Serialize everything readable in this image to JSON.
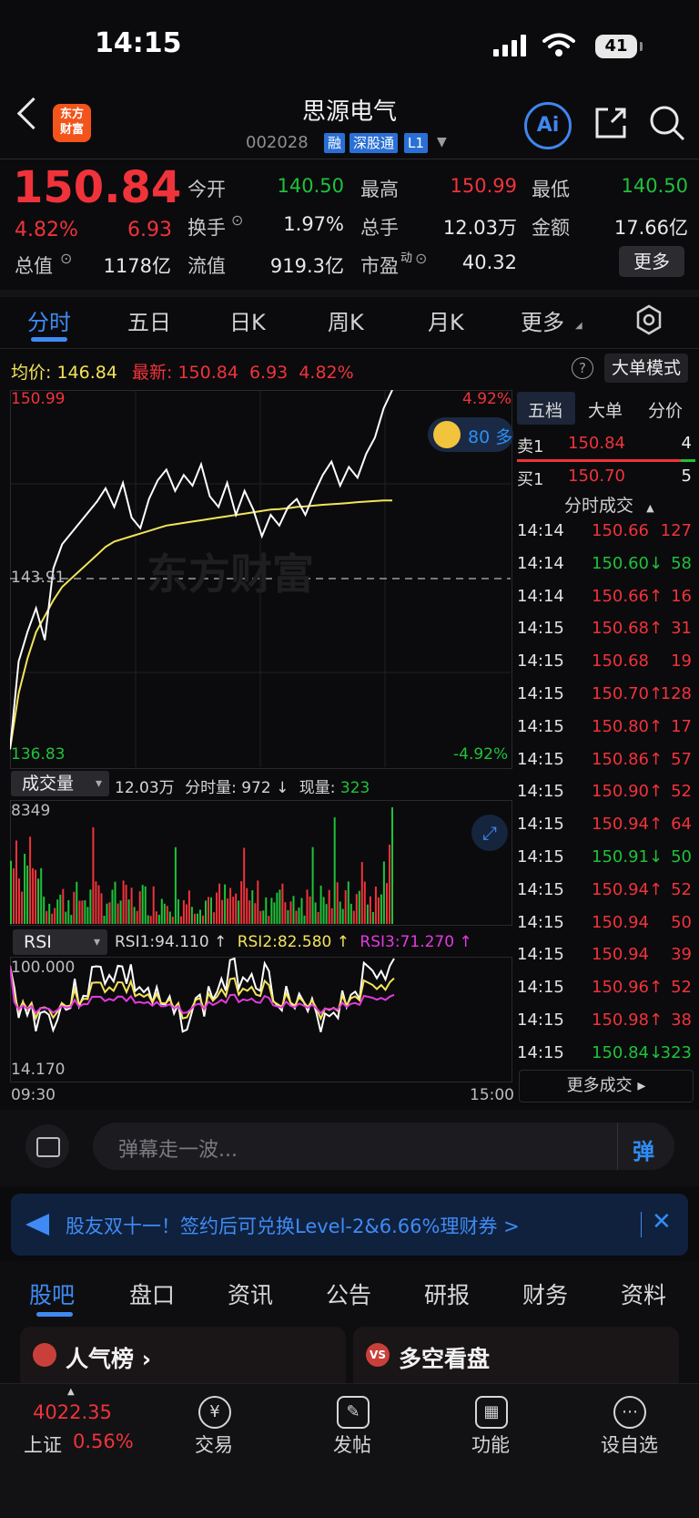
{
  "status_bar": {
    "time": "14:15",
    "battery": "41"
  },
  "header": {
    "logo_text": "东方\n财富",
    "stock_name": "思源电气",
    "stock_code": "002028",
    "tags": [
      "融",
      "深股通",
      "L1"
    ],
    "ai_label": "Ai"
  },
  "quote": {
    "price": "150.84",
    "change_pct": "4.82%",
    "change": "6.93",
    "open_label": "今开",
    "open": "140.50",
    "high_label": "最高",
    "high": "150.99",
    "low_label": "最低",
    "low": "140.50",
    "turnover_label": "换手",
    "turnover": "1.97%",
    "volume_label": "总手",
    "volume": "12.03万",
    "amount_label": "金额",
    "amount": "17.66亿",
    "mcap_label": "总值",
    "mcap": "1178亿",
    "float_label": "流值",
    "float": "919.3亿",
    "pe_label": "市盈",
    "pe_sup": "动",
    "pe": "40.32",
    "more_label": "更多"
  },
  "chart_tabs": [
    "分时",
    "五日",
    "日K",
    "周K",
    "月K",
    "更多"
  ],
  "intraday": {
    "avg_label": "均价:",
    "avg": "146.84",
    "latest_label": "最新:",
    "latest": "150.84",
    "latest_change": "6.93",
    "latest_pct": "4.82%",
    "big_order_label": "大单模式",
    "y_max": "150.99",
    "y_max_pct": "4.92%",
    "y_mid": "143.91",
    "y_min": "136.83",
    "y_min_pct": "-4.92%",
    "watermark": "东方财富",
    "bubble_text": "80 多",
    "time_start": "09:30",
    "time_end": "15:00"
  },
  "chart_data": {
    "type": "line",
    "series": [
      {
        "name": "价格",
        "values": [
          137.5,
          140.8,
          141.9,
          142.8,
          141.6,
          144.3,
          145.2,
          145.6,
          146.0,
          146.4,
          146.8,
          147.3,
          146.6,
          147.5,
          146.2,
          145.8,
          146.9,
          147.6,
          148.0,
          147.2,
          147.8,
          147.4,
          148.2,
          147.0,
          146.6,
          147.5,
          146.3,
          147.2,
          146.5,
          145.5,
          146.3,
          145.9,
          146.6,
          146.9,
          146.3,
          147.1,
          147.8,
          148.3,
          147.4,
          148.1,
          147.7,
          148.6,
          149.2,
          150.3,
          150.99
        ]
      },
      {
        "name": "均价",
        "values": [
          137.5,
          139.6,
          140.9,
          141.9,
          142.5,
          143.1,
          143.6,
          143.9,
          144.2,
          144.5,
          144.8,
          145.1,
          145.3,
          145.4,
          145.5,
          145.6,
          145.7,
          145.8,
          145.9,
          145.95,
          146.0,
          146.05,
          146.1,
          146.15,
          146.2,
          146.25,
          146.3,
          146.35,
          146.4,
          146.45,
          146.5,
          146.52,
          146.55,
          146.6,
          146.62,
          146.65,
          146.68,
          146.7,
          146.72,
          146.75,
          146.78,
          146.8,
          146.82,
          146.84,
          146.84
        ]
      }
    ],
    "y_range": [
      136.83,
      150.99
    ]
  },
  "order_book": {
    "tabs": [
      "五档",
      "大单",
      "分价"
    ],
    "ask1_label": "卖1",
    "ask1_price": "150.84",
    "ask1_vol": "4",
    "bid1_label": "买1",
    "bid1_price": "150.70",
    "bid1_vol": "5",
    "trades_title": "分时成交",
    "trades": [
      {
        "time": "14:14",
        "price": "150.66",
        "arrow": "",
        "vol": "127",
        "color": "red"
      },
      {
        "time": "14:14",
        "price": "150.60",
        "arrow": "↓",
        "vol": "58",
        "color": "green"
      },
      {
        "time": "14:14",
        "price": "150.66",
        "arrow": "↑",
        "vol": "16",
        "color": "red"
      },
      {
        "time": "14:15",
        "price": "150.68",
        "arrow": "↑",
        "vol": "31",
        "color": "red"
      },
      {
        "time": "14:15",
        "price": "150.68",
        "arrow": "",
        "vol": "19",
        "color": "red"
      },
      {
        "time": "14:15",
        "price": "150.70",
        "arrow": "↑",
        "vol": "128",
        "color": "red"
      },
      {
        "time": "14:15",
        "price": "150.80",
        "arrow": "↑",
        "vol": "17",
        "color": "red"
      },
      {
        "time": "14:15",
        "price": "150.86",
        "arrow": "↑",
        "vol": "57",
        "color": "red"
      },
      {
        "time": "14:15",
        "price": "150.90",
        "arrow": "↑",
        "vol": "52",
        "color": "red"
      },
      {
        "time": "14:15",
        "price": "150.94",
        "arrow": "↑",
        "vol": "64",
        "color": "red"
      },
      {
        "time": "14:15",
        "price": "150.91",
        "arrow": "↓",
        "vol": "50",
        "color": "green"
      },
      {
        "time": "14:15",
        "price": "150.94",
        "arrow": "↑",
        "vol": "52",
        "color": "red"
      },
      {
        "time": "14:15",
        "price": "150.94",
        "arrow": "",
        "vol": "50",
        "color": "red"
      },
      {
        "time": "14:15",
        "price": "150.94",
        "arrow": "",
        "vol": "39",
        "color": "red"
      },
      {
        "time": "14:15",
        "price": "150.96",
        "arrow": "↑",
        "vol": "52",
        "color": "red"
      },
      {
        "time": "14:15",
        "price": "150.98",
        "arrow": "↑",
        "vol": "38",
        "color": "red"
      },
      {
        "time": "14:15",
        "price": "150.84",
        "arrow": "↓",
        "vol": "323",
        "color": "green"
      }
    ],
    "more_trades": "更多成交 ▸"
  },
  "volume": {
    "selector": "成交量",
    "total": "12.03万",
    "period_label": "分时量:",
    "period": "972 ↓",
    "current_label": "现量:",
    "current": "323",
    "max": "8349"
  },
  "rsi": {
    "selector": "RSI",
    "rsi1": "RSI1:94.110 ↑",
    "rsi2": "RSI2:82.580 ↑",
    "rsi3": "RSI3:71.270 ↑",
    "max": "100.000",
    "min": "14.170"
  },
  "danmu": {
    "placeholder": "弹幕走一波...",
    "send": "弹"
  },
  "promo": {
    "text": "股友双十一！签约后可兑换Level-2&6.66%理财券 >"
  },
  "bottom_tabs": [
    "股吧",
    "盘口",
    "资讯",
    "公告",
    "研报",
    "财务",
    "资料"
  ],
  "cards": [
    {
      "title": "人气榜 ›"
    },
    {
      "title": "多空看盘"
    }
  ],
  "nav": {
    "index_value": "4022.35",
    "index_name": "上证",
    "index_pct": "0.56%",
    "items": [
      "交易",
      "发帖",
      "功能",
      "设自选"
    ]
  }
}
